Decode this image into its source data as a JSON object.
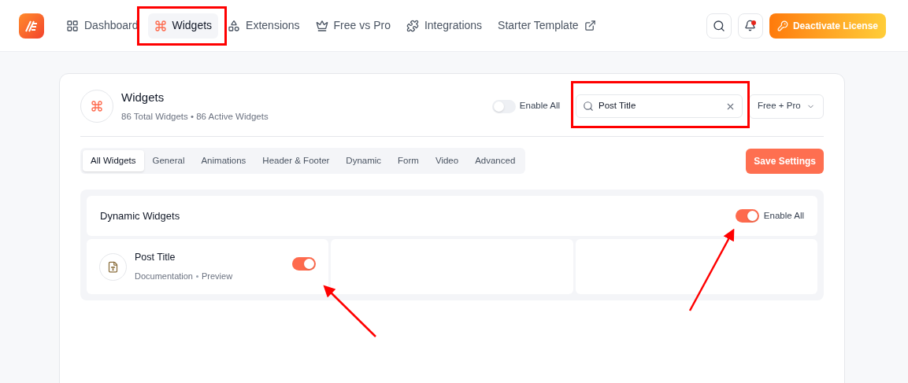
{
  "nav": {
    "items": [
      {
        "label": "Dashboard",
        "selected": false
      },
      {
        "label": "Widgets",
        "selected": true
      },
      {
        "label": "Extensions",
        "selected": false
      },
      {
        "label": "Free vs Pro",
        "selected": false
      },
      {
        "label": "Integrations",
        "selected": false
      },
      {
        "label": "Starter Template",
        "selected": false
      }
    ],
    "license_button": "Deactivate License",
    "notification_dot": true
  },
  "panel": {
    "title": "Widgets",
    "subtitle": "86 Total Widgets • 86 Active Widgets",
    "enable_all": {
      "label": "Enable All",
      "on": false
    },
    "search": {
      "value": "Post Title"
    },
    "filter": "Free + Pro",
    "tabs": [
      {
        "label": "All Widgets",
        "selected": true
      },
      {
        "label": "General",
        "selected": false
      },
      {
        "label": "Animations",
        "selected": false
      },
      {
        "label": "Header & Footer",
        "selected": false
      },
      {
        "label": "Dynamic",
        "selected": false
      },
      {
        "label": "Form",
        "selected": false
      },
      {
        "label": "Video",
        "selected": false
      },
      {
        "label": "Advanced",
        "selected": false
      }
    ],
    "save_button": "Save Settings",
    "section": {
      "title": "Dynamic Widgets",
      "enable_all": {
        "label": "Enable All",
        "on": true
      },
      "widgets": [
        {
          "name": "Post Title",
          "links": [
            "Documentation",
            "Preview"
          ],
          "on": true
        }
      ]
    }
  }
}
